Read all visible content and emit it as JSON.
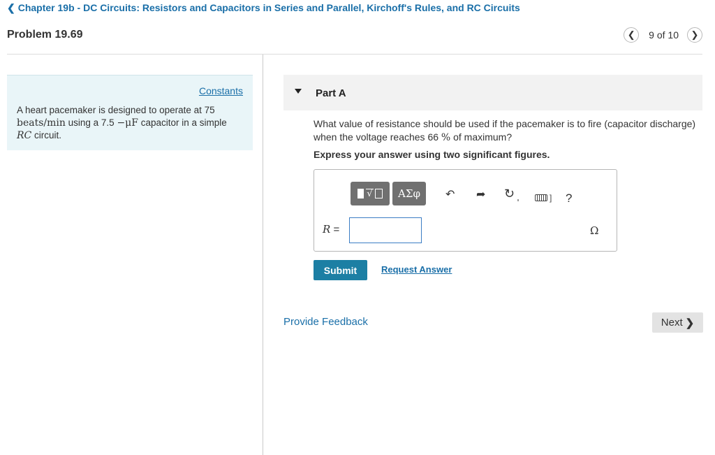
{
  "header": {
    "chapter_link": "Chapter 19b - DC Circuits: Resistors and Capacitors in Series and Parallel, Kirchoff's Rules, and RC Circuits",
    "problem_title": "Problem 19.69",
    "pager_text": "9 of 10",
    "prev_icon": "chevron-left-icon",
    "next_icon": "chevron-right-icon"
  },
  "sidebar": {
    "constants_link": "Constants",
    "problem_text": {
      "t1": "A heart pacemaker is designed to operate at 75",
      "unit_rate": "beats/min",
      "t2": " using a 7.5 ",
      "cap_unit": "−μF",
      "t3": " capacitor in a simple",
      "circuit_sym": "RC",
      "t4": " circuit."
    }
  },
  "part": {
    "title": "Part A",
    "question_1": "What value of resistance should be used if the pacemaker is to fire (capacitor discharge) when the voltage reaches 66 ",
    "percent": "%",
    "question_2": " of maximum?",
    "instruction": "Express your answer using two significant figures.",
    "toolbar": {
      "templates_icon": "templates-icon",
      "symbols_label": "ΑΣφ",
      "undo_icon": "undo-icon",
      "redo_icon": "redo-icon",
      "reset_icon": "reset-icon",
      "keyboard_icon": "keyboard-icon",
      "help_label": "?"
    },
    "answer": {
      "variable": "R",
      "equals": " =",
      "value": "",
      "unit": "Ω"
    },
    "submit_label": "Submit",
    "request_answer_label": "Request Answer"
  },
  "footer": {
    "feedback_label": "Provide Feedback",
    "next_label": "Next"
  }
}
